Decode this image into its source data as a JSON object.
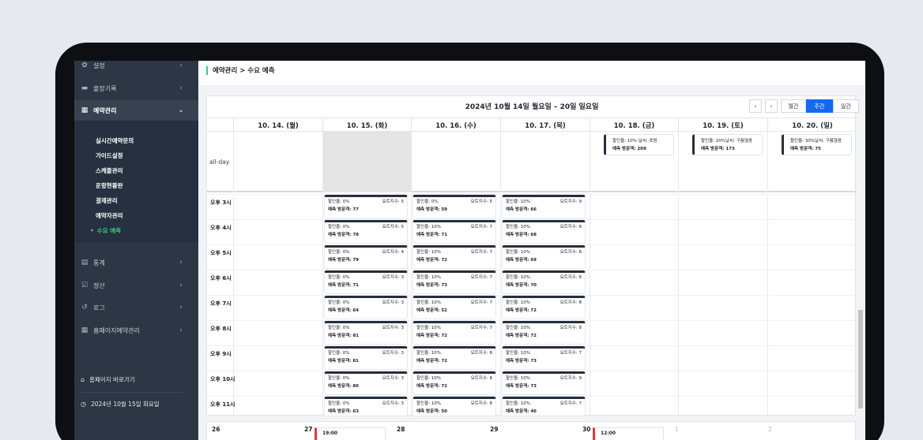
{
  "sidebar": {
    "items": [
      {
        "label": "설정",
        "icon": "gear-icon"
      },
      {
        "label": "출장기록",
        "icon": "folder-icon"
      },
      {
        "label": "예약관리",
        "icon": "calendar-icon"
      },
      {
        "label": "통계",
        "icon": "document-icon"
      },
      {
        "label": "정산",
        "icon": "check-icon"
      },
      {
        "label": "로그",
        "icon": "history-icon"
      },
      {
        "label": "홈페이지예약관리",
        "icon": "calendar-icon"
      }
    ],
    "sub_items": [
      "실시간예약문의",
      "가이드설정",
      "스케줄관리",
      "운항현황판",
      "결제관리",
      "예약자관리",
      "수요 예측"
    ],
    "footer": {
      "home_link": "홈페이지 바로가기",
      "date": "2024년 10월 15일 화요일"
    }
  },
  "header": {
    "breadcrumb": "예약관리 > 수요 예측"
  },
  "calendar": {
    "title": "2024년 10월 14일 월요일 – 20일 일요일",
    "view_buttons": [
      "월간",
      "주간",
      "일간"
    ],
    "active_view": "주간",
    "prev": "‹",
    "next": "›",
    "all_day_label": "all-day",
    "days": [
      "10. 14. (월)",
      "10. 15. (화)",
      "10. 16. (수)",
      "10. 17. (목)",
      "10. 18. (금)",
      "10. 19. (토)",
      "10. 20. (일)"
    ],
    "all_day_events": [
      {
        "line1": "할인율: 10%     날씨: 흐림",
        "line2": "예측 방문객: 209"
      },
      {
        "line1": "할인율: 20%날씨: 구름많음",
        "line2": "예측 방문객: 173"
      },
      {
        "line1": "할인율: 30%날씨: 구름많음",
        "line2": "예측 방문객: 75"
      }
    ],
    "time_slots": [
      "오후 3시",
      "오후 4시",
      "오후 5시",
      "오후 6시",
      "오후 7시",
      "오후 8시",
      "오후 9시",
      "오후 10시",
      "오후 11시"
    ],
    "events": {
      "tue": [
        {
          "rate": "할인율: 0%",
          "cnt": "요트지수: 5",
          "visit": "예측 방문객: 77"
        },
        {
          "rate": "할인율: 0%",
          "cnt": "요트지수: 5",
          "visit": "예측 방문객: 78"
        },
        {
          "rate": "할인율: 0%",
          "cnt": "요트지수: 4",
          "visit": "예측 방문객: 79"
        },
        {
          "rate": "할인율: 0%",
          "cnt": "요트지수: 3",
          "visit": "예측 방문객: 71"
        },
        {
          "rate": "할인율: 0%",
          "cnt": "요트지수: 3",
          "visit": "예측 방문객: 64"
        },
        {
          "rate": "할인율: 0%",
          "cnt": "요트지수: 3",
          "visit": "예측 방문객: 81"
        },
        {
          "rate": "할인율: 0%",
          "cnt": "요트지수: 3",
          "visit": "예측 방문객: 81"
        },
        {
          "rate": "할인율: 0%",
          "cnt": "요트지수: 3",
          "visit": "예측 방문객: 80"
        },
        {
          "rate": "할인율: 0%",
          "cnt": "요트지수: 3",
          "visit": "예측 방문객: 63"
        }
      ],
      "wed": [
        {
          "rate": "할인율: 0%",
          "cnt": "요트지수: 5",
          "visit": "예측 방문객: 59"
        },
        {
          "rate": "할인율: 10%",
          "cnt": "요트지수: 7",
          "visit": "예측 방문객: 71"
        },
        {
          "rate": "할인율: 10%",
          "cnt": "요트지수: 7",
          "visit": "예측 방문객: 72"
        },
        {
          "rate": "할인율: 10%",
          "cnt": "요트지수: 7",
          "visit": "예측 방문객: 73"
        },
        {
          "rate": "할인율: 10%",
          "cnt": "요트지수: 7",
          "visit": "예측 방문객: 52"
        },
        {
          "rate": "할인율: 10%",
          "cnt": "요트지수: 7",
          "visit": "예측 방문객: 72"
        },
        {
          "rate": "할인율: 10%",
          "cnt": "요트지수: 8",
          "visit": "예측 방문객: 72"
        },
        {
          "rate": "할인율: 10%",
          "cnt": "요트지수: 8",
          "visit": "예측 방문객: 72"
        },
        {
          "rate": "할인율: 10%",
          "cnt": "요트지수: 8",
          "visit": "예측 방문객: 50"
        }
      ],
      "thu": [
        {
          "rate": "할인율: 10%",
          "cnt": "요트지수: 9",
          "visit": "예측 방문객: 66"
        },
        {
          "rate": "할인율: 10%",
          "cnt": "요트지수: 8",
          "visit": "예측 방문객: 68"
        },
        {
          "rate": "할인율: 10%",
          "cnt": "요트지수: 8",
          "visit": "예측 방문객: 69"
        },
        {
          "rate": "할인율: 10%",
          "cnt": "요트지수: 8",
          "visit": "예측 방문객: 70"
        },
        {
          "rate": "할인율: 10%",
          "cnt": "요트지수: 8",
          "visit": "예측 방문객: 72"
        },
        {
          "rate": "할인율: 10%",
          "cnt": "요트지수: 8",
          "visit": "예측 방문객: 72"
        },
        {
          "rate": "할인율: 10%",
          "cnt": "요트지수: 7",
          "visit": "예측 방문객: 73"
        },
        {
          "rate": "할인율: 10%",
          "cnt": "요트지수: 9",
          "visit": "예측 방문객: 73"
        },
        {
          "rate": "할인율: 10%",
          "cnt": "요트지수: 7",
          "visit": "예측 방문객: 46"
        }
      ]
    }
  },
  "month_strip": {
    "days": [
      "26",
      "27",
      "28",
      "29",
      "30",
      "1",
      "2"
    ],
    "cards": [
      "19:00",
      "12:00"
    ]
  }
}
